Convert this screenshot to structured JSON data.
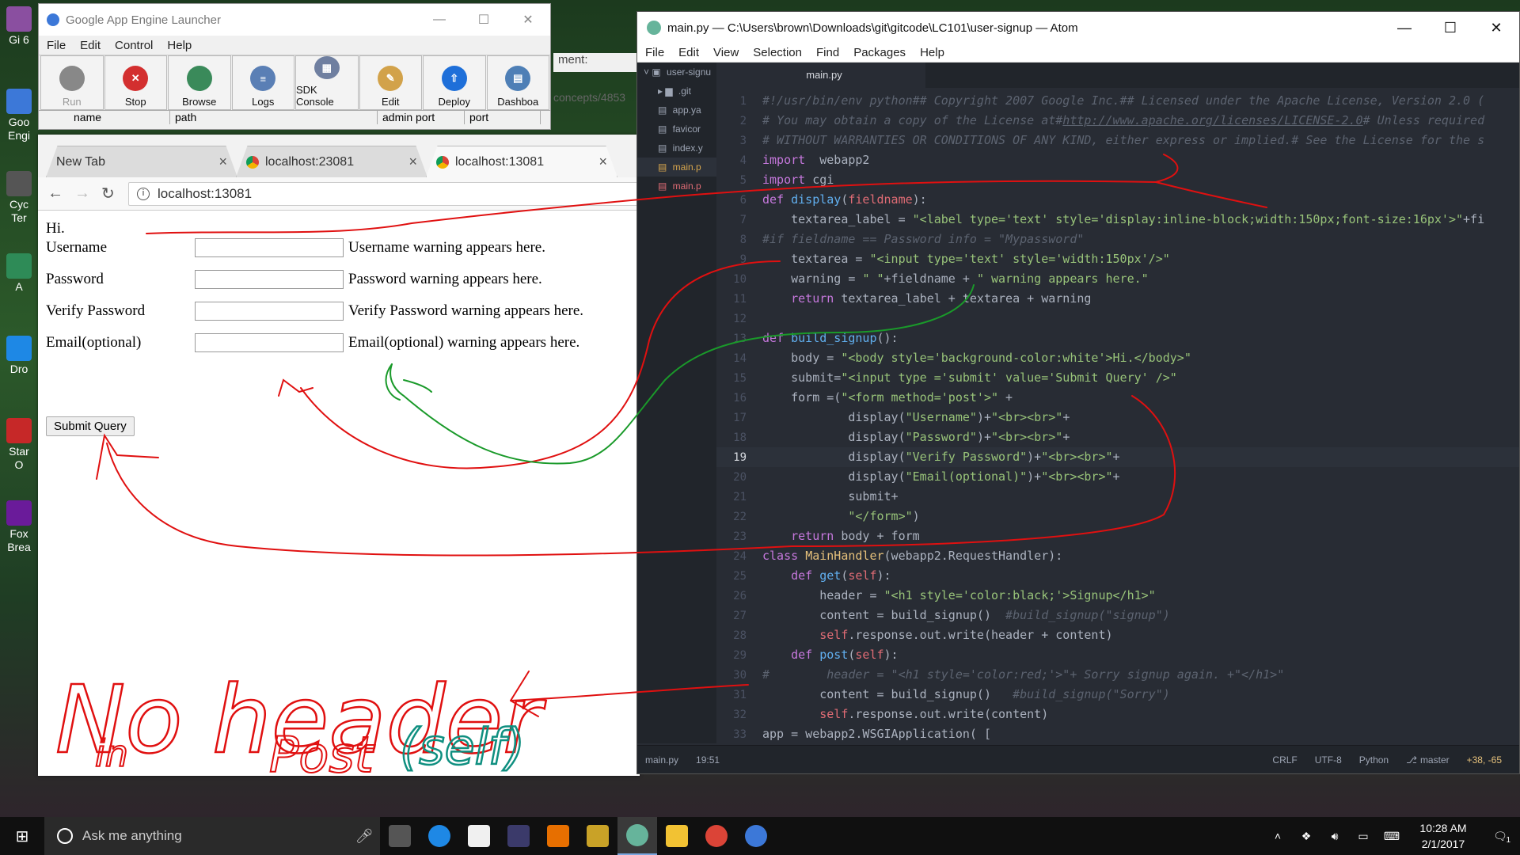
{
  "desktop": {
    "icons": [
      {
        "label": "Gi 6",
        "color": "#8a4fa0"
      },
      {
        "label": "Goo Engi",
        "color": "#3c78d8"
      },
      {
        "label": "Cyc Ter",
        "color": "#555"
      },
      {
        "label": "A",
        "color": "#2e8b57"
      },
      {
        "label": "Dro",
        "color": "#1e88e5"
      },
      {
        "label": "Star O",
        "color": "#c62828"
      },
      {
        "label": "Fox Brea",
        "color": "#6a1b9a"
      }
    ]
  },
  "gae": {
    "title": "Google App Engine Launcher",
    "menu": [
      "File",
      "Edit",
      "Control",
      "Help"
    ],
    "tools": [
      {
        "label": "Run",
        "color": "#888888",
        "glyph": ""
      },
      {
        "label": "Stop",
        "color": "#d32f2f",
        "glyph": "✕"
      },
      {
        "label": "Browse",
        "color": "#3a8a5a",
        "glyph": ""
      },
      {
        "label": "Logs",
        "color": "#5a7fb5",
        "glyph": "≡"
      },
      {
        "label": "SDK Console",
        "color": "#6f7fa0",
        "glyph": "▦"
      },
      {
        "label": "Edit",
        "color": "#d2a24a",
        "glyph": "✎"
      },
      {
        "label": "Deploy",
        "color": "#1e6fd9",
        "glyph": "⇧"
      },
      {
        "label": "Dashboa",
        "color": "#4e7fb6",
        "glyph": "▤"
      }
    ],
    "columns": [
      "name",
      "path",
      "admin port",
      "port"
    ],
    "behind_text": "ment:",
    "behind_text2": "concepts/4853"
  },
  "chrome": {
    "tabs": [
      {
        "label": "New Tab",
        "active": false
      },
      {
        "label": "localhost:23081",
        "active": false
      },
      {
        "label": "localhost:13081",
        "active": true
      }
    ],
    "url": "localhost:13081",
    "page": {
      "greeting": "Hi.",
      "fields": [
        {
          "label": "Username",
          "warning": "Username warning appears here."
        },
        {
          "label": "Password",
          "warning": "Password warning appears here."
        },
        {
          "label": "Verify Password",
          "warning": "Verify Password warning appears here."
        },
        {
          "label": "Email(optional)",
          "warning": "Email(optional) warning appears here."
        }
      ],
      "submit": "Submit Query"
    }
  },
  "atom": {
    "title": "main.py — C:\\Users\\brown\\Downloads\\git\\gitcode\\LC101\\user-signup — Atom",
    "menu": [
      "File",
      "Edit",
      "View",
      "Selection",
      "Find",
      "Packages",
      "Help"
    ],
    "tree": [
      {
        "label": "user-signu",
        "kind": "root"
      },
      {
        "label": ".git",
        "kind": "folder"
      },
      {
        "label": "app.ya",
        "kind": "file"
      },
      {
        "label": "favicor",
        "kind": "file"
      },
      {
        "label": "index.y",
        "kind": "file"
      },
      {
        "label": "main.p",
        "kind": "sel"
      },
      {
        "label": "main.p",
        "kind": "lib"
      }
    ],
    "tab": "main.py",
    "status": {
      "file": "main.py",
      "cursor": "19:51",
      "eol": "CRLF",
      "encoding": "UTF-8",
      "grammar": "Python",
      "branch": "master",
      "diff": "+38, -65"
    },
    "current_line": 19,
    "lines": [
      [
        [
          "cm",
          "#!/usr/bin/env python## Copyright 2007 Google Inc.## Licensed under the Apache License, Version 2.0 ("
        ]
      ],
      [
        [
          "cm",
          "# You may obtain a copy of the License at#"
        ],
        [
          "lk",
          "http://www.apache.org/licenses/LICENSE-2.0"
        ],
        [
          "cm",
          "# Unless required"
        ]
      ],
      [
        [
          "cm",
          "# WITHOUT WARRANTIES OR CONDITIONS OF ANY KIND, either express or implied.# See the License for the s"
        ]
      ],
      [
        [
          "kw",
          "import"
        ],
        [
          "",
          "  webapp2"
        ]
      ],
      [
        [
          "kw",
          "import"
        ],
        [
          "",
          " cgi"
        ]
      ],
      [
        [
          "kw",
          "def"
        ],
        [
          "",
          " "
        ],
        [
          "fn",
          "display"
        ],
        [
          "",
          "("
        ],
        [
          "sf",
          "fieldname"
        ],
        [
          "",
          "):"
        ]
      ],
      [
        [
          "",
          "    textarea_label = "
        ],
        [
          "st",
          "\"<label type='text' style='display:inline-block;width:150px;font-size:16px'>\""
        ],
        [
          "",
          "+fi"
        ]
      ],
      [
        [
          "cm",
          "#if fieldname == Password info = \"Mypassword\""
        ]
      ],
      [
        [
          "",
          "    textarea = "
        ],
        [
          "st",
          "\"<input type='text' style='width:150px'/>\""
        ]
      ],
      [
        [
          "",
          "    warning = "
        ],
        [
          "st",
          "\" \""
        ],
        [
          "",
          "+fieldname + "
        ],
        [
          "st",
          "\" warning appears here.\""
        ]
      ],
      [
        [
          "",
          "    "
        ],
        [
          "kw",
          "return"
        ],
        [
          "",
          " textarea_label + textarea + warning"
        ]
      ],
      [
        [
          "",
          ""
        ]
      ],
      [
        [
          "kw",
          "def"
        ],
        [
          "",
          " "
        ],
        [
          "fn",
          "build_signup"
        ],
        [
          "",
          "():"
        ]
      ],
      [
        [
          "",
          "    body = "
        ],
        [
          "st",
          "\"<body style='background-color:white'>Hi.</body>\""
        ]
      ],
      [
        [
          "",
          "    submit="
        ],
        [
          "st",
          "\"<input type ='submit' value='Submit Query' />\""
        ]
      ],
      [
        [
          "",
          "    form =("
        ],
        [
          "st",
          "\"<form method='post'>\""
        ],
        [
          "",
          " +"
        ]
      ],
      [
        [
          "",
          "            display("
        ],
        [
          "st",
          "\"Username\""
        ],
        [
          "",
          ")+"
        ],
        [
          "st",
          "\"<br><br>\""
        ],
        [
          "",
          "+"
        ]
      ],
      [
        [
          "",
          "            display("
        ],
        [
          "st",
          "\"Password\""
        ],
        [
          "",
          ")+"
        ],
        [
          "st",
          "\"<br><br>\""
        ],
        [
          "",
          "+"
        ]
      ],
      [
        [
          "",
          "            display("
        ],
        [
          "st",
          "\"Verify Password\""
        ],
        [
          "",
          ")+"
        ],
        [
          "st",
          "\"<br><br>\""
        ],
        [
          "",
          "+"
        ]
      ],
      [
        [
          "",
          "            display("
        ],
        [
          "st",
          "\"Email(optional)\""
        ],
        [
          "",
          ")+"
        ],
        [
          "st",
          "\"<br><br>\""
        ],
        [
          "",
          "+"
        ]
      ],
      [
        [
          "",
          "            submit+"
        ]
      ],
      [
        [
          "",
          "            "
        ],
        [
          "st",
          "\"</form>\""
        ],
        [
          "",
          ")"
        ]
      ],
      [
        [
          "",
          "    "
        ],
        [
          "kw",
          "return"
        ],
        [
          "",
          " body + form"
        ]
      ],
      [
        [
          "kw",
          "class"
        ],
        [
          "",
          " "
        ],
        [
          "cl",
          "MainHandler"
        ],
        [
          "",
          "(webapp2.RequestHandler):"
        ]
      ],
      [
        [
          "",
          "    "
        ],
        [
          "kw",
          "def"
        ],
        [
          "",
          " "
        ],
        [
          "fn",
          "get"
        ],
        [
          "",
          "("
        ],
        [
          "sf",
          "self"
        ],
        [
          "",
          "):"
        ]
      ],
      [
        [
          "",
          "        header = "
        ],
        [
          "st",
          "\"<h1 style='color:black;'>Signup</h1>\""
        ]
      ],
      [
        [
          "",
          "        content = build_signup()  "
        ],
        [
          "cm",
          "#build_signup(\"signup\")"
        ]
      ],
      [
        [
          "",
          "        "
        ],
        [
          "sf",
          "self"
        ],
        [
          "",
          ".response.out.write(header + content)"
        ]
      ],
      [
        [
          "",
          "    "
        ],
        [
          "kw",
          "def"
        ],
        [
          "",
          " "
        ],
        [
          "fn",
          "post"
        ],
        [
          "",
          "("
        ],
        [
          "sf",
          "self"
        ],
        [
          "",
          "):"
        ]
      ],
      [
        [
          "cm",
          "#        header = \"<h1 style='color:red;'>\"+ Sorry signup again. +\"</h1>\""
        ]
      ],
      [
        [
          "",
          "        content = build_signup()   "
        ],
        [
          "cm",
          "#build_signup(\"Sorry\")"
        ]
      ],
      [
        [
          "",
          "        "
        ],
        [
          "sf",
          "self"
        ],
        [
          "",
          ".response.out.write(content)"
        ]
      ],
      [
        [
          "",
          "app = webapp2.WSGIApplication( ["
        ]
      ]
    ]
  },
  "annotation": {
    "line1": "No header",
    "line2": "in",
    "line3": "Post",
    "line4": "(self)",
    "ink_red": "#e01010",
    "ink_green": "#1a9a2a",
    "ink_teal": "#0f8f80"
  },
  "taskbar": {
    "search_placeholder": "Ask me anything",
    "apps": [
      {
        "name": "task-view",
        "color": "#555"
      },
      {
        "name": "edge",
        "color": "#1e88e5"
      },
      {
        "name": "store",
        "color": "#f0f0f0"
      },
      {
        "name": "eclipse",
        "color": "#3b3a6a"
      },
      {
        "name": "java",
        "color": "#e76f00"
      },
      {
        "name": "tools",
        "color": "#c9a227"
      },
      {
        "name": "atom",
        "color": "#66b49b"
      },
      {
        "name": "explorer",
        "color": "#f2c233"
      },
      {
        "name": "chrome",
        "color": "#db4437"
      },
      {
        "name": "gae",
        "color": "#3c78d8"
      }
    ],
    "time": "10:28 AM",
    "date": "2/1/2017",
    "notif_count": "1"
  }
}
